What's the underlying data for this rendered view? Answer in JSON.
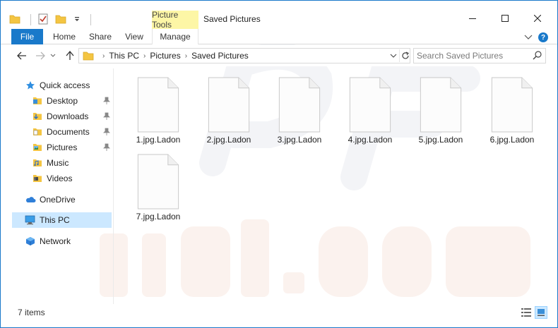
{
  "window": {
    "title": "Saved Pictures",
    "contextual_tab": "Picture Tools",
    "minimize_icon": "minimize-icon",
    "maximize_icon": "maximize-icon",
    "close_icon": "close-icon",
    "border_color": "#1979ca"
  },
  "ribbon": {
    "tabs": [
      {
        "label": "File",
        "active": true
      },
      {
        "label": "Home"
      },
      {
        "label": "Share"
      },
      {
        "label": "View"
      },
      {
        "label": "Manage"
      }
    ],
    "help": "?",
    "accent_color": "#1979ca",
    "contextual_color": "#fdf6a6"
  },
  "address": {
    "crumbs": [
      "This PC",
      "Pictures",
      "Saved Pictures"
    ],
    "search_placeholder": "Search Saved Pictures"
  },
  "nav": {
    "quick_access": "Quick access",
    "pinned": [
      {
        "label": "Desktop",
        "icon": "desktop-folder-icon"
      },
      {
        "label": "Downloads",
        "icon": "downloads-folder-icon"
      },
      {
        "label": "Documents",
        "icon": "documents-folder-icon"
      },
      {
        "label": "Pictures",
        "icon": "pictures-folder-icon"
      }
    ],
    "unpinned": [
      {
        "label": "Music",
        "icon": "music-folder-icon"
      },
      {
        "label": "Videos",
        "icon": "videos-folder-icon"
      }
    ],
    "onedrive": "OneDrive",
    "this_pc": "This PC",
    "network": "Network",
    "selected_color": "#cce8ff"
  },
  "files": [
    {
      "name": "1.jpg.Ladon"
    },
    {
      "name": "2.jpg.Ladon"
    },
    {
      "name": "3.jpg.Ladon"
    },
    {
      "name": "4.jpg.Ladon"
    },
    {
      "name": "5.jpg.Ladon"
    },
    {
      "name": "6.jpg.Ladon"
    },
    {
      "name": "7.jpg.Ladon"
    }
  ],
  "status": {
    "count_text": "7 items",
    "view_details_icon": "details-view-icon",
    "view_large_icon": "large-icons-view-icon"
  }
}
